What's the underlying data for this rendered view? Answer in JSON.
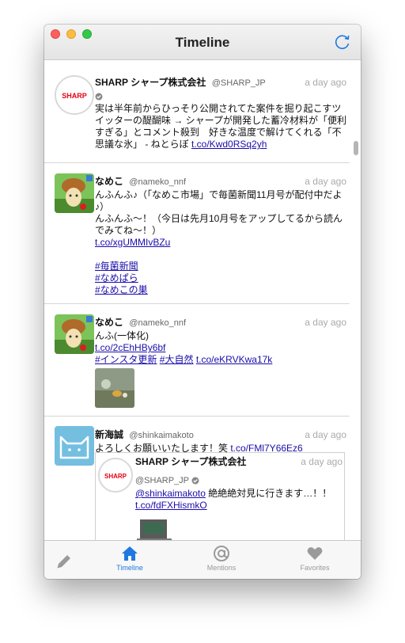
{
  "window": {
    "title": "Timeline"
  },
  "colors": {
    "accent": "#1f78e0",
    "link": "#1a0dab",
    "muted": "#999999"
  },
  "tweets": [
    {
      "name": "SHARP シャープ株式会社",
      "handle": "@SHARP_JP",
      "time": "a day ago",
      "avatar": "sharp-logo",
      "text1": "実は半年前からひっそり公開されてた案件を掘り起こすツイッターの醍醐味 → シャープが開発した蓄冷材料が「便利すぎる」とコメント殺到　好きな温度で解けてくれる「不思議な氷」 - ねとらぼ ",
      "link1": "t.co/Kwd0RSq2yh"
    },
    {
      "name": "なめこ",
      "handle": "@nameko_nnf",
      "time": "a day ago",
      "avatar": "nameko",
      "text1": "んふんふ♪（「なめこ市場」で毎菌新聞11月号が配付中だよ♪）",
      "text2": "んふんふ〜！（今日は先月10月号をアップしてるから読んでみてね〜！）",
      "link1": "t.co/xgUMMIvBZu",
      "tags": [
        "#毎菌新聞",
        "#なめぱら",
        "#なめこの巣"
      ]
    },
    {
      "name": "なめこ",
      "handle": "@nameko_nnf",
      "time": "a day ago",
      "avatar": "nameko",
      "text1": "んふ(一体化)",
      "link1": "t.co/2cEhHBy6bf",
      "tags": [
        "#インスタ更新",
        "#大自然"
      ],
      "link2": "t.co/eKRVKwa17k"
    },
    {
      "name": "新海誠",
      "handle": "@shinkaimakoto",
      "time": "a day ago",
      "avatar": "cat",
      "text1": "よろしくお願いいたします！笑 ",
      "link1": "t.co/FMl7Y66Ez6",
      "quote": {
        "name": "SHARP シャープ株式会社",
        "handle": "@SHARP_JP",
        "time": "a day ago",
        "mention": "@shinkaimakoto",
        "text": " 絶絶絶対見に行きます…！！",
        "link": "t.co/fdFXHismkO"
      }
    }
  ],
  "tabs": [
    {
      "label": "",
      "icon": "compose-icon"
    },
    {
      "label": "Timeline",
      "icon": "home-icon"
    },
    {
      "label": "Mentions",
      "icon": "at-icon"
    },
    {
      "label": "Favorites",
      "icon": "heart-icon"
    }
  ]
}
